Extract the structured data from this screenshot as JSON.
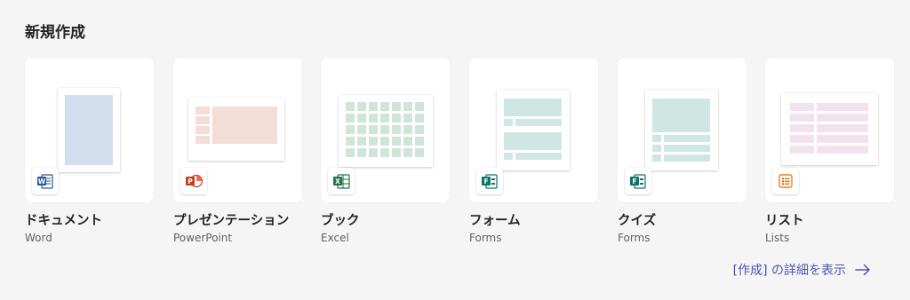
{
  "section": {
    "title": "新規作成"
  },
  "cards": [
    {
      "title": "ドキュメント",
      "app": "Word",
      "icon": "word-icon",
      "accent": "#2b579a",
      "preview": "#d3deef"
    },
    {
      "title": "プレゼンテーション",
      "app": "PowerPoint",
      "icon": "powerpoint-icon",
      "accent": "#c43e1c",
      "preview": "#f2ddd7"
    },
    {
      "title": "ブック",
      "app": "Excel",
      "icon": "excel-icon",
      "accent": "#217346",
      "preview": "#cfe5d8"
    },
    {
      "title": "フォーム",
      "app": "Forms",
      "icon": "forms-icon",
      "accent": "#077568",
      "preview": "#cfe6e3"
    },
    {
      "title": "クイズ",
      "app": "Forms",
      "icon": "forms-icon",
      "accent": "#077568",
      "preview": "#cfe6e3"
    },
    {
      "title": "リスト",
      "app": "Lists",
      "icon": "lists-icon",
      "accent": "#e8811a",
      "preview": "#f1e2ee"
    }
  ],
  "more": {
    "label": "[作成] の詳細を表示",
    "icon": "arrow-right-icon",
    "color": "#4f52b2"
  }
}
